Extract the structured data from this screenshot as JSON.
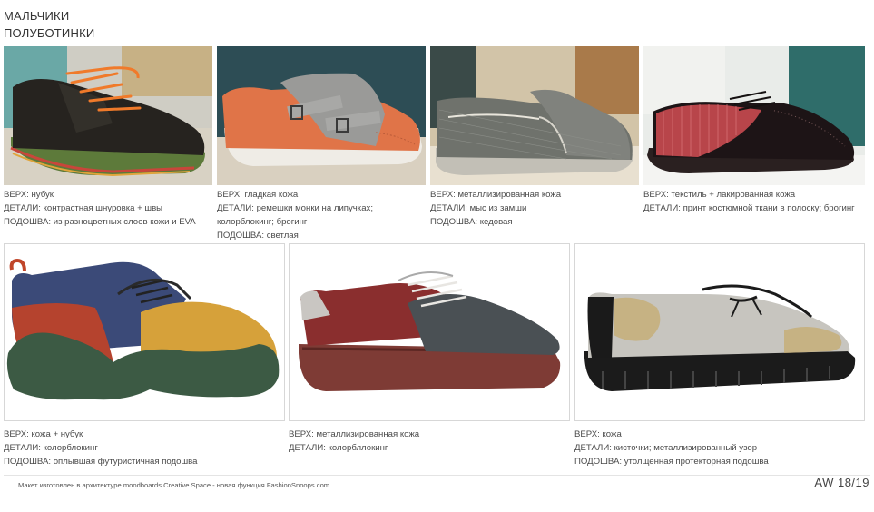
{
  "header": {
    "category": "МАЛЬЧИКИ",
    "subcategory": "ПОЛУБОТИНКИ"
  },
  "products": [
    {
      "lines": [
        "ВЕРХ: нубук",
        "ДЕТАЛИ: контрастная шнуровка + швы",
        "ПОДОШВА: из разноцветных слоев кожи и EVA"
      ]
    },
    {
      "lines": [
        "ВЕРХ: гладкая кожа",
        "ДЕТАЛИ: ремешки монки на липучках;",
        "колорблокинг; брогинг",
        "ПОДОШВА: светлая"
      ]
    },
    {
      "lines": [
        "ВЕРХ: металлизированная кожа",
        "ДЕТАЛИ: мыс из замши",
        "ПОДОШВА: кедовая"
      ]
    },
    {
      "lines": [
        "ВЕРХ: текстиль + лакированная кожа",
        "ДЕТАЛИ: принт костюмной ткани в полоску; брогинг"
      ]
    },
    {
      "lines": [
        "ВЕРХ: кожа + нубук",
        "ДЕТАЛИ:  колорблокинг",
        "ПОДОШВА: оплывшая футуристичная подошва"
      ]
    },
    {
      "lines": [
        "ВЕРХ: металлизированная кожа",
        "ДЕТАЛИ: колорбллокинг"
      ]
    },
    {
      "lines": [
        "ВЕРХ: кожа",
        "ДЕТАЛИ: кисточки; металлизированный узор",
        "ПОДОШВА: утолщенная протекторная подошва"
      ]
    }
  ],
  "footer": {
    "note": "Макет изготовлен в архитектуре moodboards Creative Space - новая функция FashionSnoops.com",
    "season": "AW 18/19"
  }
}
